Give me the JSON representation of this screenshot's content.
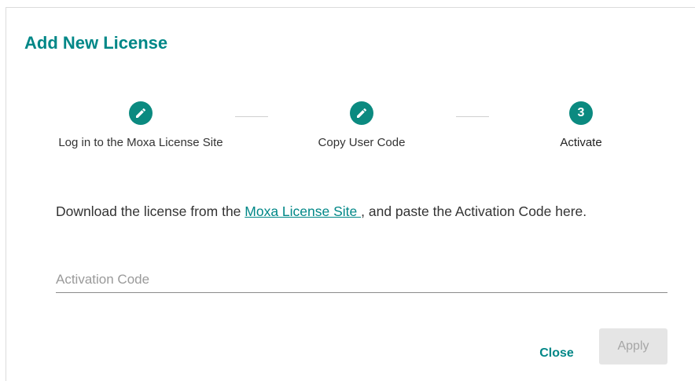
{
  "dialog": {
    "title": "Add New License"
  },
  "stepper": {
    "steps": [
      {
        "label": "Log in to the Moxa License Site",
        "state": "completed",
        "icon": "pencil-icon"
      },
      {
        "label": "Copy User Code",
        "state": "completed",
        "icon": "pencil-icon"
      },
      {
        "label": "Activate",
        "state": "active",
        "number": "3"
      }
    ]
  },
  "instructions": {
    "before_link": "Download the license from the ",
    "link_text": "Moxa License Site ",
    "after_link": ", and paste the Activation Code here."
  },
  "activation_field": {
    "placeholder": "Activation Code",
    "value": ""
  },
  "actions": {
    "close_label": "Close",
    "apply_label": "Apply"
  },
  "colors": {
    "accent": "#008787",
    "step_circle": "#0b8a80",
    "disabled_bg": "#e5e5e5",
    "disabled_text": "#a6a6a6"
  }
}
